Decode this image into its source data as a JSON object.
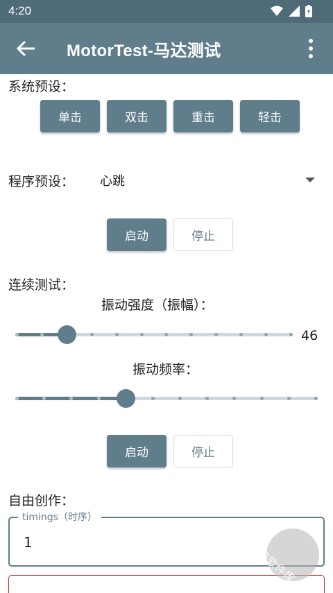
{
  "status": {
    "time": "4:20"
  },
  "appbar": {
    "title": "MotorTest-马达测试",
    "back_icon": "arrow-back-icon",
    "more_icon": "more-vert-icon"
  },
  "system_presets": {
    "label": "系统预设：",
    "buttons": [
      "单击",
      "双击",
      "重击",
      "轻击"
    ]
  },
  "program_presets": {
    "label": "程序预设：",
    "selected": "心跳"
  },
  "program_actions": {
    "start": "启动",
    "stop": "停止"
  },
  "continuous": {
    "label": "连续测试：",
    "intensity_label": "振动强度（振幅）：",
    "intensity_value": "46",
    "intensity_fraction": 0.184,
    "frequency_label": "振动频率：",
    "frequency_fraction": 0.364
  },
  "continuous_actions": {
    "start": "启动",
    "stop": "停止"
  },
  "free_creation": {
    "label": "自由创作：",
    "timings_label": "timings（时序）",
    "timings_value": "1"
  },
  "watermark": "千景软件库",
  "colors": {
    "primary": "#607d8b",
    "status_bar": "#4f6b78",
    "track": "#cfd8dc",
    "error": "#c62828"
  }
}
